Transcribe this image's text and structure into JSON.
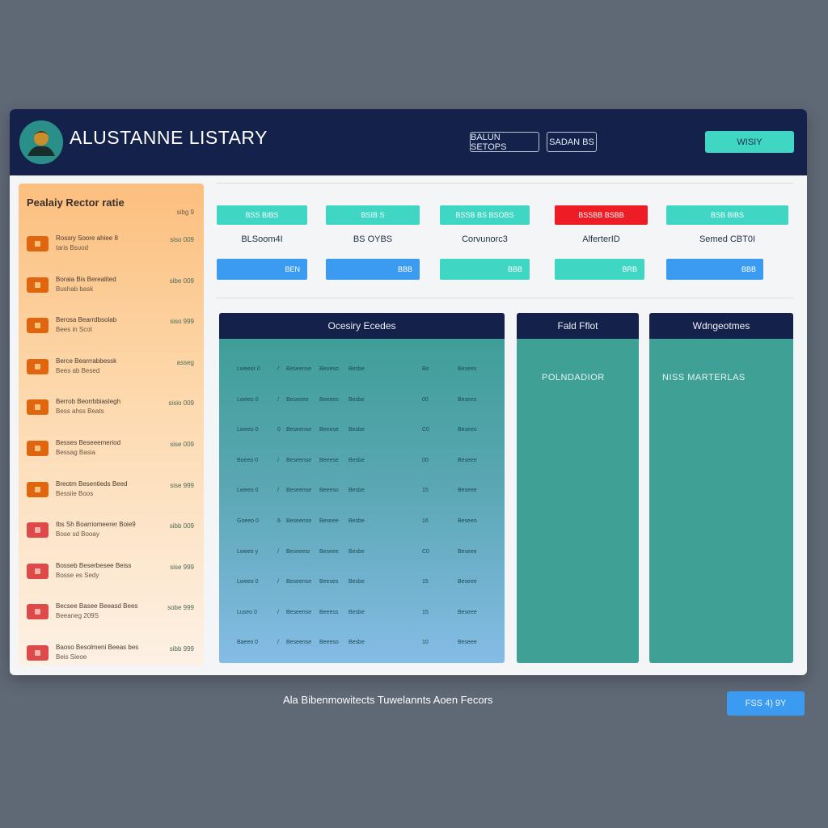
{
  "app": {
    "title": "ALUSTANNE LISTARY",
    "header_buttons": [
      "BALUN SETOPS",
      "SADAN BS"
    ],
    "cta_label": "WISIY"
  },
  "sidebar": {
    "title": "Pealaiy Rector ratie",
    "subtitle": "sibg 9",
    "items": [
      {
        "line1": "Rossry Soore ahiee 8",
        "line2": "taris Bsuod",
        "value": "siso 009",
        "color": "orange"
      },
      {
        "line1": "Boraia Bis Berealited",
        "line2": "Bushab bask",
        "value": "sibe 009",
        "color": "orange"
      },
      {
        "line1": "Berosa Bearrdbsolab",
        "line2": "Bees in Scot",
        "value": "siso 999",
        "color": "orange"
      },
      {
        "line1": "Berce Bearrrabbessk",
        "line2": "Bees ab Besed",
        "value": "asseg",
        "color": "orange"
      },
      {
        "line1": "Berrob Beorrbbiaslegh",
        "line2": "Bess ahss Beats",
        "value": "sisio 009",
        "color": "orange"
      },
      {
        "line1": "Besses Beseeemeriod",
        "line2": "Bessag Basia",
        "value": "sise 009",
        "color": "orange"
      },
      {
        "line1": "Breotm Besentieds Beed",
        "line2": "Bessiie Boos",
        "value": "sise 999",
        "color": "orange"
      },
      {
        "line1": "Ibs Sh Boarriomeerer Boie9",
        "line2": "Bose sd Booay",
        "value": "sibb 009",
        "color": "red"
      },
      {
        "line1": "Bosseb Beserbesee Beiss",
        "line2": "Bosse es Sedy",
        "value": "sise 999",
        "color": "red"
      },
      {
        "line1": "Becsee Basee Beeasd Bees",
        "line2": "Beeaneg 209S",
        "value": "sobe 999",
        "color": "red"
      },
      {
        "line1": "Baoso Besolmeni Beeas bes",
        "line2": "Beis Sieoe",
        "value": "sibb 999",
        "color": "red"
      }
    ]
  },
  "metrics": [
    {
      "top": "BSS BIBS",
      "label": "BLSoom4I",
      "bottom": "BEN",
      "top_color": "#3fd6c4",
      "bottom_color": "#3b9bf0"
    },
    {
      "top": "BSIB S",
      "label": "BS OYBS",
      "bottom": "BBB",
      "top_color": "#3fd6c4",
      "bottom_color": "#3b9bf0"
    },
    {
      "top": "BSSB BS BSOBS",
      "label": "Corvunorc3",
      "bottom": "BBB",
      "top_color": "#3fd6c4",
      "bottom_color": "#3fd6c4"
    },
    {
      "top": "BSSBB BSBB",
      "label": "AlferterID",
      "bottom": "BRB",
      "top_color": "#ee1c24",
      "bottom_color": "#3fd6c4"
    },
    {
      "top": "BSB BIBS",
      "label": "Semed CBT0I",
      "bottom": "BBB",
      "top_color": "#3fd6c4",
      "bottom_color": "#3b9bf0"
    }
  ],
  "panels": {
    "history": {
      "title": "Ocesiry Ecedes",
      "rows": [
        [
          "Lweeor 0",
          "/",
          "Beseense",
          "Beoeso",
          "Besbe",
          "Bo",
          "Besees"
        ],
        [
          "Lweeo 0",
          "/",
          "Beseeee",
          "Beeees",
          "Besbe",
          "00",
          "Besees"
        ],
        [
          "Lweeo 0",
          "0",
          "Beseense",
          "Beeese",
          "Besbe",
          "C0",
          "Beseeo"
        ],
        [
          "Boeeo 0",
          "/",
          "Beseense",
          "Beeese",
          "Besbe",
          "00",
          "Beseee"
        ],
        [
          "Lweeo 0",
          "/",
          "Beseense",
          "Beeeso",
          "Besbe",
          "15",
          "Beseee"
        ],
        [
          "Goeeo 0",
          "6",
          "Beseense",
          "Beseee",
          "Besbe",
          "16",
          "Beseeo"
        ],
        [
          "Lweeo y",
          "/",
          "Beseeesr",
          "Beseee",
          "Besbe",
          "C0",
          "Beseee"
        ],
        [
          "Lweeo 0",
          "/",
          "Beseense",
          "Beeses",
          "Besbe",
          "15",
          "Beseee"
        ],
        [
          "Luseo 0",
          "/",
          "Beseense",
          "Beeess",
          "Besbe",
          "15",
          "Beseee"
        ],
        [
          "Baeeo 0",
          "/",
          "Beseense",
          "Beeeso",
          "Besbe",
          "10",
          "Beseee"
        ]
      ]
    },
    "profile": {
      "title": "Fald Fflot",
      "body": "POLNDADIOR"
    },
    "widgets": {
      "title": "Wdngeotmes",
      "body": "NISS MARTERLAS"
    }
  },
  "footer": {
    "text": "Ala Bibenmowitects Tuwelannts Aoen Fecors",
    "button_label": "FSS 4) 9Y"
  }
}
